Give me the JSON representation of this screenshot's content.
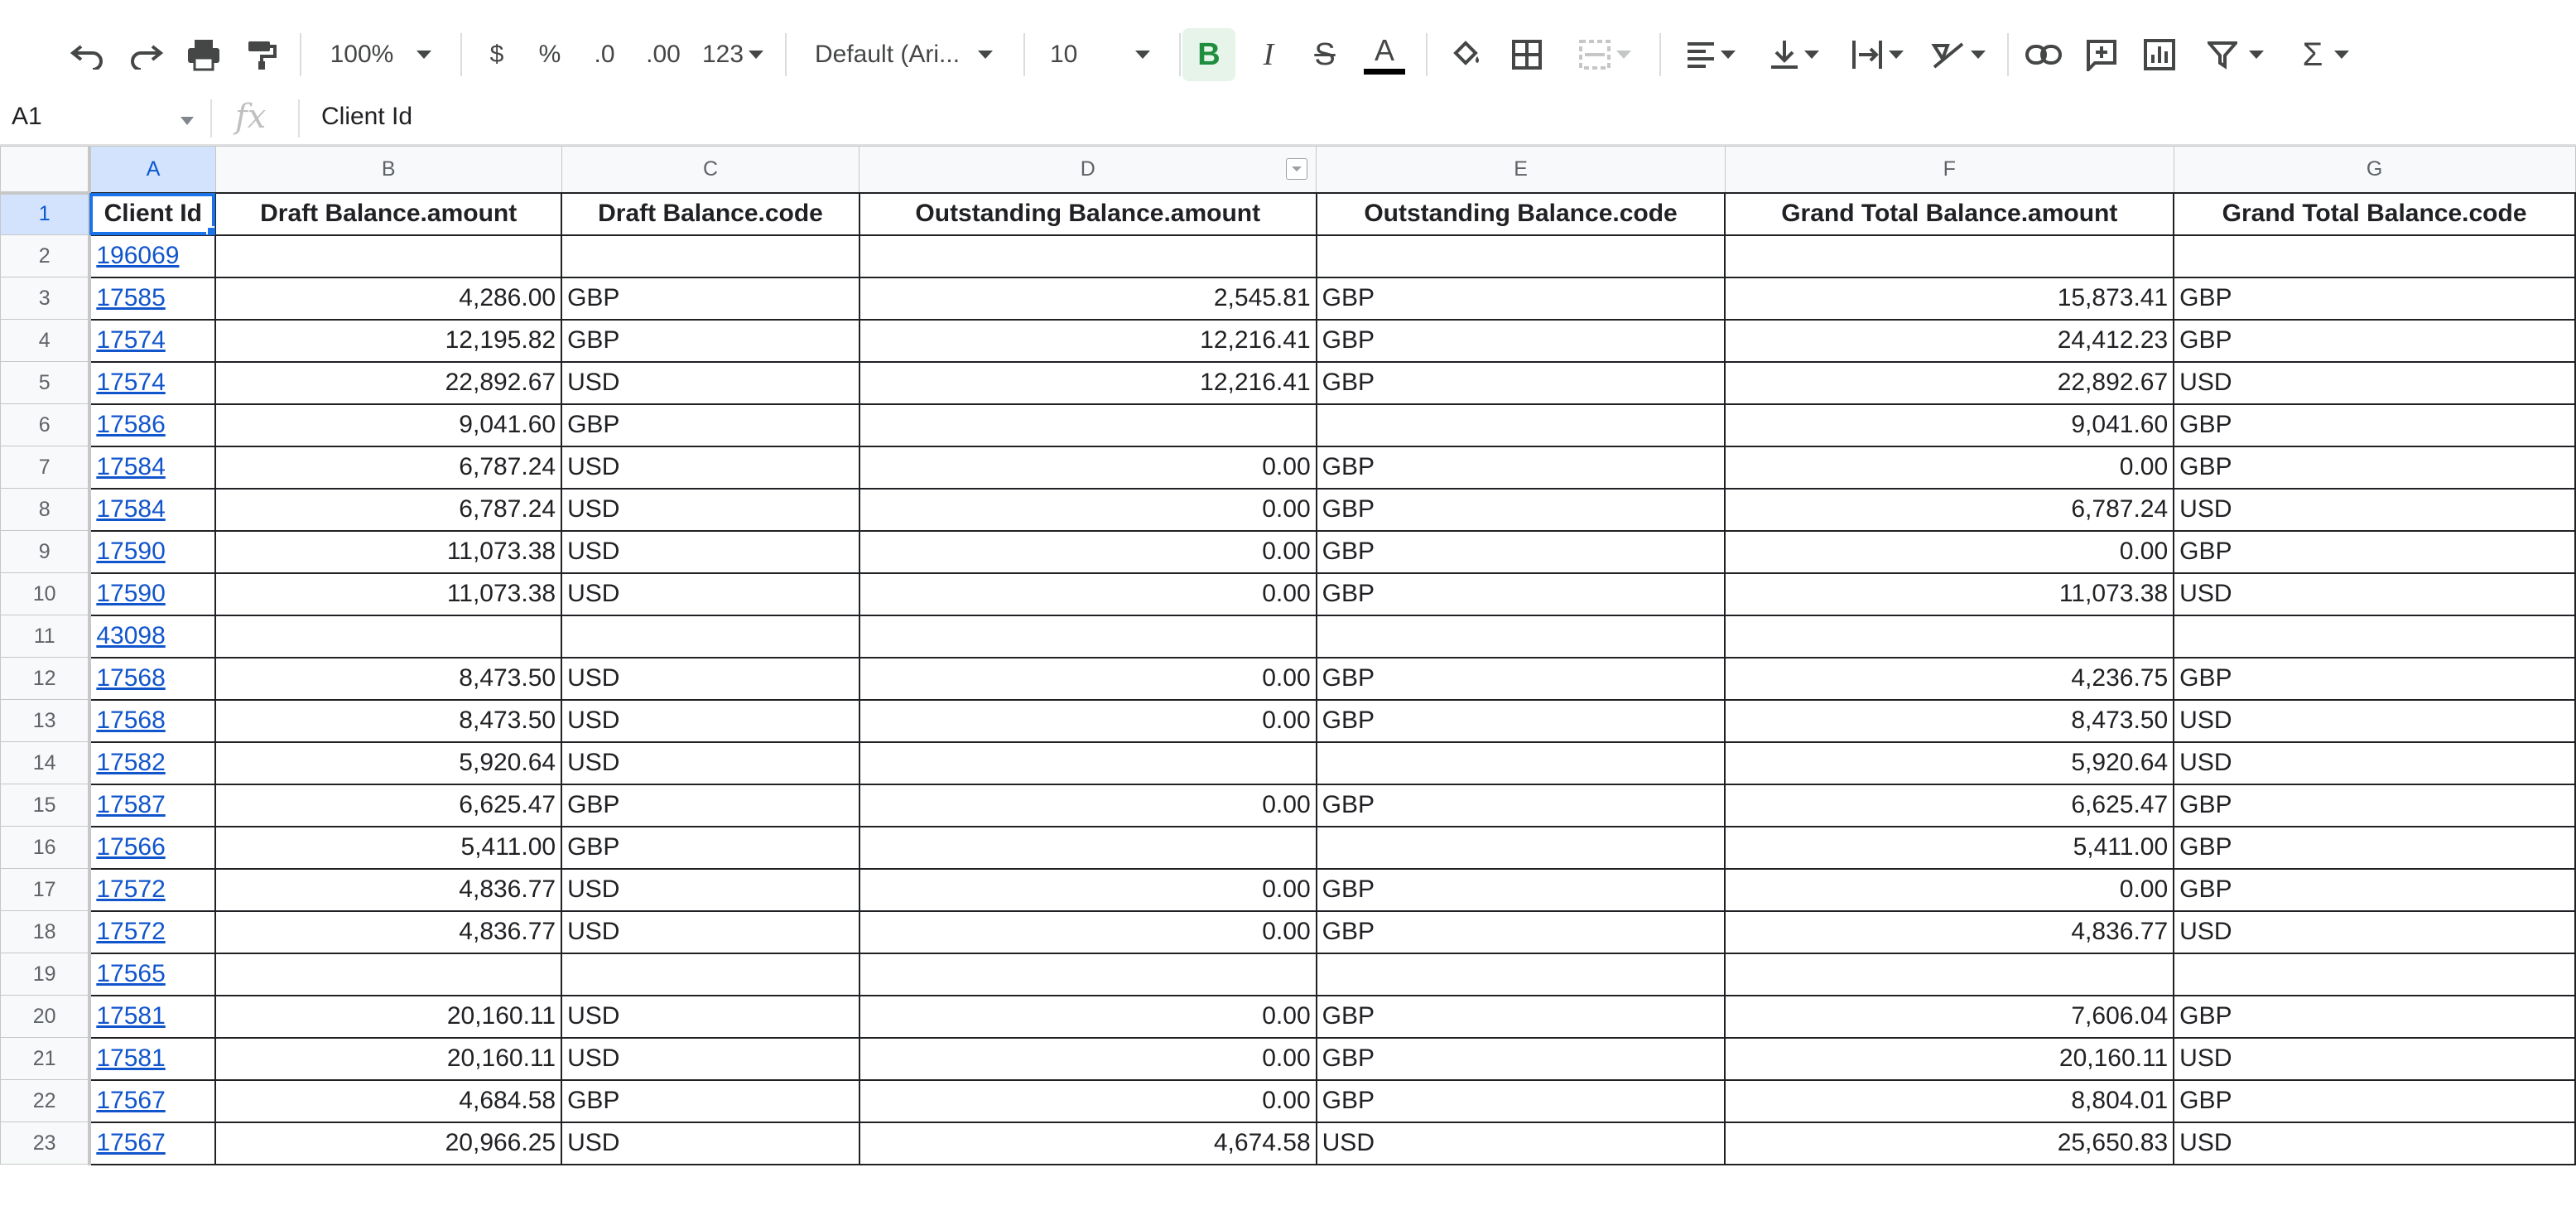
{
  "toolbar": {
    "zoom": "100%",
    "currency": "$",
    "percent": "%",
    "decimal_decrease": ".0",
    "decimal_increase": ".00",
    "more_formats": "123",
    "font_family": "Default (Ari...",
    "font_size": "10",
    "bold": "B",
    "italic": "I",
    "strike": "S",
    "text_color": "A",
    "sum": "Σ"
  },
  "formula_bar": {
    "name_box": "A1",
    "fx": "fx",
    "content": "Client Id"
  },
  "columns": [
    "A",
    "B",
    "C",
    "D",
    "E",
    "F",
    "G"
  ],
  "header_row": {
    "row_number": "1",
    "cells": [
      "Client Id",
      "Draft Balance.amount",
      "Draft Balance.code",
      "Outstanding Balance.amount",
      "Outstanding Balance.code",
      "Grand Total Balance.amount",
      "Grand Total Balance.code"
    ]
  },
  "rows": [
    {
      "n": "2",
      "cells": [
        "196069",
        "",
        "",
        "",
        "",
        "",
        ""
      ]
    },
    {
      "n": "3",
      "cells": [
        "17585",
        "4,286.00",
        "GBP",
        "2,545.81",
        "GBP",
        "15,873.41",
        "GBP"
      ]
    },
    {
      "n": "4",
      "cells": [
        "17574",
        "12,195.82",
        "GBP",
        "12,216.41",
        "GBP",
        "24,412.23",
        "GBP"
      ]
    },
    {
      "n": "5",
      "cells": [
        "17574",
        "22,892.67",
        "USD",
        "12,216.41",
        "GBP",
        "22,892.67",
        "USD"
      ]
    },
    {
      "n": "6",
      "cells": [
        "17586",
        "9,041.60",
        "GBP",
        "",
        "",
        "9,041.60",
        "GBP"
      ]
    },
    {
      "n": "7",
      "cells": [
        "17584",
        "6,787.24",
        "USD",
        "0.00",
        "GBP",
        "0.00",
        "GBP"
      ]
    },
    {
      "n": "8",
      "cells": [
        "17584",
        "6,787.24",
        "USD",
        "0.00",
        "GBP",
        "6,787.24",
        "USD"
      ]
    },
    {
      "n": "9",
      "cells": [
        "17590",
        "11,073.38",
        "USD",
        "0.00",
        "GBP",
        "0.00",
        "GBP"
      ]
    },
    {
      "n": "10",
      "cells": [
        "17590",
        "11,073.38",
        "USD",
        "0.00",
        "GBP",
        "11,073.38",
        "USD"
      ]
    },
    {
      "n": "11",
      "cells": [
        "43098",
        "",
        "",
        "",
        "",
        "",
        ""
      ]
    },
    {
      "n": "12",
      "cells": [
        "17568",
        "8,473.50",
        "USD",
        "0.00",
        "GBP",
        "4,236.75",
        "GBP"
      ]
    },
    {
      "n": "13",
      "cells": [
        "17568",
        "8,473.50",
        "USD",
        "0.00",
        "GBP",
        "8,473.50",
        "USD"
      ]
    },
    {
      "n": "14",
      "cells": [
        "17582",
        "5,920.64",
        "USD",
        "",
        "",
        "5,920.64",
        "USD"
      ]
    },
    {
      "n": "15",
      "cells": [
        "17587",
        "6,625.47",
        "GBP",
        "0.00",
        "GBP",
        "6,625.47",
        "GBP"
      ]
    },
    {
      "n": "16",
      "cells": [
        "17566",
        "5,411.00",
        "GBP",
        "",
        "",
        "5,411.00",
        "GBP"
      ]
    },
    {
      "n": "17",
      "cells": [
        "17572",
        "4,836.77",
        "USD",
        "0.00",
        "GBP",
        "0.00",
        "GBP"
      ]
    },
    {
      "n": "18",
      "cells": [
        "17572",
        "4,836.77",
        "USD",
        "0.00",
        "GBP",
        "4,836.77",
        "USD"
      ]
    },
    {
      "n": "19",
      "cells": [
        "17565",
        "",
        "",
        "",
        "",
        "",
        ""
      ]
    },
    {
      "n": "20",
      "cells": [
        "17581",
        "20,160.11",
        "USD",
        "0.00",
        "GBP",
        "7,606.04",
        "GBP"
      ]
    },
    {
      "n": "21",
      "cells": [
        "17581",
        "20,160.11",
        "USD",
        "0.00",
        "GBP",
        "20,160.11",
        "USD"
      ]
    },
    {
      "n": "22",
      "cells": [
        "17567",
        "4,684.58",
        "GBP",
        "0.00",
        "GBP",
        "8,804.01",
        "GBP"
      ]
    },
    {
      "n": "23",
      "cells": [
        "17567",
        "20,966.25",
        "USD",
        "4,674.58",
        "USD",
        "25,650.83",
        "USD"
      ]
    }
  ],
  "colors": {
    "link": "#1155cc",
    "selection": "#1a73e8",
    "bold_active": "#1e8e3e"
  }
}
